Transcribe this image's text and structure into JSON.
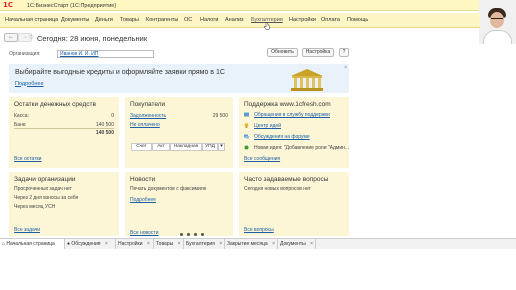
{
  "window": {
    "title": "1С:БизнесСтарт  (1С:Предприятие)",
    "logo": "1С"
  },
  "menu": {
    "items": [
      "Начальная страница",
      "Документы",
      "Деньги",
      "Товары",
      "Контрагенты",
      "ОС",
      "Налоги",
      "Анализ",
      "Бухгалтерия",
      "Настройки",
      "Оплата",
      "Помощь"
    ],
    "active": "Бухгалтерия"
  },
  "toolbar": {
    "back": "←",
    "forward": "→",
    "star": "☆",
    "page_title": "Сегодня: 28 июня, понедельник"
  },
  "org": {
    "label": "Организация:",
    "value": "Иванов И. И. ИП",
    "refresh_label": "Обновить",
    "settings_label": "Настройка",
    "help_label": "?"
  },
  "promo": {
    "text": "Выбирайте выгодные кредиты и оформляйте заявки прямо в 1С",
    "link": "Подробнее",
    "close": "×"
  },
  "cash": {
    "title": "Остатки денежных средств",
    "rows": [
      {
        "label": "Касса:",
        "value": "0"
      },
      {
        "label": "Банк:",
        "value": "140 500"
      }
    ],
    "total": "140 500",
    "footer": "Все остатки"
  },
  "buyers": {
    "title": "Покупатели",
    "debt_label": "Задолженность",
    "debt_value": "29 500",
    "unpaid_label": "Не оплачено",
    "tabs": [
      "Счет",
      "Акт",
      "Накладная",
      "УПД"
    ],
    "tab_arrow": "▾"
  },
  "support": {
    "title": "Поддержка www.1cfresh.com",
    "items": [
      "Обращения в службу поддержки",
      "Центр идей",
      "Обсуждения на форуме",
      "Новая идея: \"Добавление роли \"Админ..."
    ],
    "footer": "Все сообщения",
    "colors": {
      "item1": "#5b9bd5",
      "item2": "#e8b62a",
      "item3": "#5aa0d8",
      "item4": "#3a9d3a"
    }
  },
  "tasks": {
    "title": "Задачи организации",
    "rows": [
      "Просроченных задач нет",
      "Через 2 дня взносы за себя",
      "Через месяц УСН"
    ],
    "footer": "Все задачи"
  },
  "news": {
    "title": "Новости",
    "text": "Печать документов с факсимиле",
    "link": "Подробнее",
    "footer": "Все новости"
  },
  "faq": {
    "title": "Часто задаваемые вопросы",
    "text": "Сегодня новых вопросов нет",
    "footer": "Все вопросы"
  },
  "taskbar": {
    "items": [
      {
        "label": "Начальная страница",
        "closable": false,
        "icon": "home-icon"
      },
      {
        "label": "Обсуждения",
        "closable": true,
        "icon": "chat-icon"
      },
      {
        "label": "Настройки",
        "closable": true
      },
      {
        "label": "Товары",
        "closable": true
      },
      {
        "label": "Бухгалтерия",
        "closable": true
      },
      {
        "label": "Закрытие месяца",
        "closable": true
      },
      {
        "label": "Документы",
        "closable": true
      }
    ],
    "close": "×"
  }
}
